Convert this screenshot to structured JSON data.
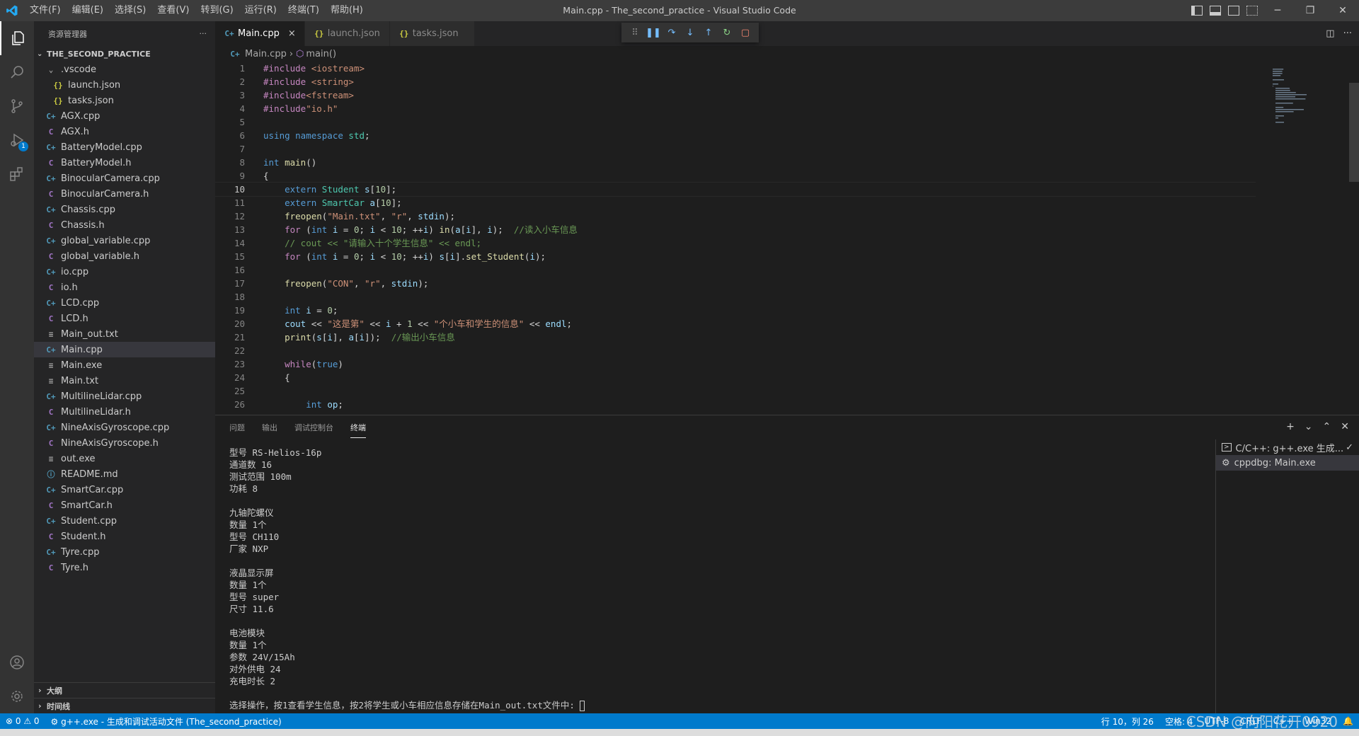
{
  "window": {
    "title": "Main.cpp - The_second_practice - Visual Studio Code",
    "menus": [
      "文件(F)",
      "编辑(E)",
      "选择(S)",
      "查看(V)",
      "转到(G)",
      "运行(R)",
      "终端(T)",
      "帮助(H)"
    ]
  },
  "activitybar": {
    "items": [
      {
        "icon": "files-icon",
        "active": true
      },
      {
        "icon": "search-icon"
      },
      {
        "icon": "source-control-icon"
      },
      {
        "icon": "run-debug-icon",
        "badge": "1"
      },
      {
        "icon": "extensions-icon"
      }
    ],
    "bottom": [
      {
        "icon": "account-icon"
      },
      {
        "icon": "settings-gear-icon"
      }
    ]
  },
  "sidebar": {
    "header": "资源管理器",
    "more": "···",
    "folder": "THE_SECOND_PRACTICE",
    "files": [
      {
        "name": ".vscode",
        "type": "folder",
        "indent": 1
      },
      {
        "name": "launch.json",
        "type": "json",
        "indent": 2
      },
      {
        "name": "tasks.json",
        "type": "json",
        "indent": 2
      },
      {
        "name": "AGX.cpp",
        "type": "cpp",
        "indent": 1
      },
      {
        "name": "AGX.h",
        "type": "h",
        "indent": 1
      },
      {
        "name": "BatteryModel.cpp",
        "type": "cpp",
        "indent": 1
      },
      {
        "name": "BatteryModel.h",
        "type": "h",
        "indent": 1
      },
      {
        "name": "BinocularCamera.cpp",
        "type": "cpp",
        "indent": 1
      },
      {
        "name": "BinocularCamera.h",
        "type": "h",
        "indent": 1
      },
      {
        "name": "Chassis.cpp",
        "type": "cpp",
        "indent": 1
      },
      {
        "name": "Chassis.h",
        "type": "h",
        "indent": 1
      },
      {
        "name": "global_variable.cpp",
        "type": "cpp",
        "indent": 1
      },
      {
        "name": "global_variable.h",
        "type": "h",
        "indent": 1
      },
      {
        "name": "io.cpp",
        "type": "cpp",
        "indent": 1
      },
      {
        "name": "io.h",
        "type": "h",
        "indent": 1
      },
      {
        "name": "LCD.cpp",
        "type": "cpp",
        "indent": 1
      },
      {
        "name": "LCD.h",
        "type": "h",
        "indent": 1
      },
      {
        "name": "Main_out.txt",
        "type": "txt",
        "indent": 1
      },
      {
        "name": "Main.cpp",
        "type": "cpp",
        "indent": 1,
        "selected": true
      },
      {
        "name": "Main.exe",
        "type": "txt",
        "indent": 1
      },
      {
        "name": "Main.txt",
        "type": "txt",
        "indent": 1
      },
      {
        "name": "MultilineLidar.cpp",
        "type": "cpp",
        "indent": 1
      },
      {
        "name": "MultilineLidar.h",
        "type": "h",
        "indent": 1
      },
      {
        "name": "NineAxisGyroscope.cpp",
        "type": "cpp",
        "indent": 1
      },
      {
        "name": "NineAxisGyroscope.h",
        "type": "h",
        "indent": 1
      },
      {
        "name": "out.exe",
        "type": "txt",
        "indent": 1
      },
      {
        "name": "README.md",
        "type": "md",
        "indent": 1
      },
      {
        "name": "SmartCar.cpp",
        "type": "cpp",
        "indent": 1
      },
      {
        "name": "SmartCar.h",
        "type": "h",
        "indent": 1
      },
      {
        "name": "Student.cpp",
        "type": "cpp",
        "indent": 1
      },
      {
        "name": "Student.h",
        "type": "h",
        "indent": 1
      },
      {
        "name": "Tyre.cpp",
        "type": "cpp",
        "indent": 1
      },
      {
        "name": "Tyre.h",
        "type": "h",
        "indent": 1
      }
    ],
    "outline": "大纲",
    "timeline": "时间线"
  },
  "tabs": [
    {
      "label": "Main.cpp",
      "type": "cpp",
      "active": true,
      "close": "×"
    },
    {
      "label": "launch.json",
      "type": "json"
    },
    {
      "label": "tasks.json",
      "type": "json"
    }
  ],
  "breadcrumb": {
    "file": "Main.cpp",
    "symbol": "main()"
  },
  "code": {
    "current_line": 10,
    "lines": [
      [
        [
          "p",
          "#include "
        ],
        [
          "s",
          "<iostream>"
        ]
      ],
      [
        [
          "p",
          "#include "
        ],
        [
          "s",
          "<string>"
        ]
      ],
      [
        [
          "p",
          "#include"
        ],
        [
          "s",
          "<fstream>"
        ]
      ],
      [
        [
          "p",
          "#include"
        ],
        [
          "s",
          "\"io.h\""
        ]
      ],
      [],
      [
        [
          "k",
          "using "
        ],
        [
          "k",
          "namespace "
        ],
        [
          "t",
          "std"
        ],
        [
          "d",
          ";"
        ]
      ],
      [],
      [
        [
          "k",
          "int "
        ],
        [
          "f",
          "main"
        ],
        [
          "d",
          "()"
        ]
      ],
      [
        [
          "d",
          "{"
        ]
      ],
      [
        [
          "d",
          "    "
        ],
        [
          "k",
          "extern "
        ],
        [
          "t",
          "Student "
        ],
        [
          "v",
          "s"
        ],
        [
          "d",
          "["
        ],
        [
          "n",
          "10"
        ],
        [
          "d",
          "];"
        ]
      ],
      [
        [
          "d",
          "    "
        ],
        [
          "k",
          "extern "
        ],
        [
          "t",
          "SmartCar "
        ],
        [
          "v",
          "a"
        ],
        [
          "d",
          "["
        ],
        [
          "n",
          "10"
        ],
        [
          "d",
          "];"
        ]
      ],
      [
        [
          "d",
          "    "
        ],
        [
          "f",
          "freopen"
        ],
        [
          "d",
          "("
        ],
        [
          "s",
          "\"Main.txt\""
        ],
        [
          "d",
          ", "
        ],
        [
          "s",
          "\"r\""
        ],
        [
          "d",
          ", "
        ],
        [
          "v",
          "stdin"
        ],
        [
          "d",
          ");"
        ]
      ],
      [
        [
          "d",
          "    "
        ],
        [
          "kc",
          "for "
        ],
        [
          "d",
          "("
        ],
        [
          "k",
          "int "
        ],
        [
          "v",
          "i "
        ],
        [
          "d",
          "= "
        ],
        [
          "n",
          "0"
        ],
        [
          "d",
          "; "
        ],
        [
          "v",
          "i "
        ],
        [
          "d",
          "< "
        ],
        [
          "n",
          "10"
        ],
        [
          "d",
          "; ++"
        ],
        [
          "v",
          "i"
        ],
        [
          "d",
          ") "
        ],
        [
          "f",
          "in"
        ],
        [
          "d",
          "("
        ],
        [
          "v",
          "a"
        ],
        [
          "d",
          "["
        ],
        [
          "v",
          "i"
        ],
        [
          "d",
          "], "
        ],
        [
          "v",
          "i"
        ],
        [
          "d",
          ");  "
        ],
        [
          "c",
          "//读入小车信息"
        ]
      ],
      [
        [
          "d",
          "    "
        ],
        [
          "c",
          "// cout << \"请输入十个学生信息\" << endl;"
        ]
      ],
      [
        [
          "d",
          "    "
        ],
        [
          "kc",
          "for "
        ],
        [
          "d",
          "("
        ],
        [
          "k",
          "int "
        ],
        [
          "v",
          "i "
        ],
        [
          "d",
          "= "
        ],
        [
          "n",
          "0"
        ],
        [
          "d",
          "; "
        ],
        [
          "v",
          "i "
        ],
        [
          "d",
          "< "
        ],
        [
          "n",
          "10"
        ],
        [
          "d",
          "; ++"
        ],
        [
          "v",
          "i"
        ],
        [
          "d",
          ") "
        ],
        [
          "v",
          "s"
        ],
        [
          "d",
          "["
        ],
        [
          "v",
          "i"
        ],
        [
          "d",
          "]."
        ],
        [
          "f",
          "set_Student"
        ],
        [
          "d",
          "("
        ],
        [
          "v",
          "i"
        ],
        [
          "d",
          ");"
        ]
      ],
      [],
      [
        [
          "d",
          "    "
        ],
        [
          "f",
          "freopen"
        ],
        [
          "d",
          "("
        ],
        [
          "s",
          "\"CON\""
        ],
        [
          "d",
          ", "
        ],
        [
          "s",
          "\"r\""
        ],
        [
          "d",
          ", "
        ],
        [
          "v",
          "stdin"
        ],
        [
          "d",
          ");"
        ]
      ],
      [],
      [
        [
          "d",
          "    "
        ],
        [
          "k",
          "int "
        ],
        [
          "v",
          "i "
        ],
        [
          "d",
          "= "
        ],
        [
          "n",
          "0"
        ],
        [
          "d",
          ";"
        ]
      ],
      [
        [
          "d",
          "    "
        ],
        [
          "v",
          "cout "
        ],
        [
          "d",
          "<< "
        ],
        [
          "s",
          "\"这是第\" "
        ],
        [
          "d",
          "<< "
        ],
        [
          "v",
          "i "
        ],
        [
          "d",
          "+ "
        ],
        [
          "n",
          "1 "
        ],
        [
          "d",
          "<< "
        ],
        [
          "s",
          "\"个小车和学生的信息\" "
        ],
        [
          "d",
          "<< "
        ],
        [
          "v",
          "endl"
        ],
        [
          "d",
          ";"
        ]
      ],
      [
        [
          "d",
          "    "
        ],
        [
          "f",
          "print"
        ],
        [
          "d",
          "("
        ],
        [
          "v",
          "s"
        ],
        [
          "d",
          "["
        ],
        [
          "v",
          "i"
        ],
        [
          "d",
          "], "
        ],
        [
          "v",
          "a"
        ],
        [
          "d",
          "["
        ],
        [
          "v",
          "i"
        ],
        [
          "d",
          "]);  "
        ],
        [
          "c",
          "//输出小车信息"
        ]
      ],
      [],
      [
        [
          "d",
          "    "
        ],
        [
          "kc",
          "while"
        ],
        [
          "d",
          "("
        ],
        [
          "k",
          "true"
        ],
        [
          "d",
          ")"
        ]
      ],
      [
        [
          "d",
          "    {"
        ]
      ],
      [],
      [
        [
          "d",
          "        "
        ],
        [
          "k",
          "int "
        ],
        [
          "v",
          "op"
        ],
        [
          "d",
          ";"
        ]
      ]
    ]
  },
  "panel": {
    "tabs": [
      "问题",
      "输出",
      "调试控制台",
      "终端"
    ],
    "active_tab": "终端",
    "actions": {
      "add": "+",
      "dropdown": "⌄",
      "maximize": "⌃",
      "close": "✕"
    },
    "terminal_lines": [
      "型号 RS-Helios-16p",
      "通道数 16",
      "测试范围 100m",
      "功耗 8",
      "",
      "九轴陀螺仪",
      "数量 1个",
      "型号 CH110",
      "厂家 NXP",
      "",
      "液晶显示屏",
      "数量 1个",
      "型号 super",
      "尺寸 11.6",
      "",
      "电池模块",
      "数量 1个",
      "参数 24V/15Ah",
      "对外供电 24",
      "充电时长 2",
      "",
      "选择操作，按1查看学生信息，按2将学生或小车相应信息存储在Main_out.txt文件中: "
    ],
    "terminals": [
      {
        "label": "C/C++: g++.exe 生成...",
        "check": "✓"
      },
      {
        "label": "cppdbg: Main.exe",
        "active": true
      }
    ]
  },
  "statusbar": {
    "problems": "⊗ 0 ⚠ 0",
    "task": "g++.exe - 生成和调试活动文件 (The_second_practice)",
    "position": "行 10，列 26",
    "spaces": "空格: 4",
    "encoding": "UTF-8",
    "eol": "CRLF",
    "language": "C++",
    "platform": "Win32"
  },
  "watermark": "CSDN @向阳花开0920",
  "colors": {
    "accent": "#007acc",
    "activity": "#333333",
    "sidebar": "#252526",
    "editor": "#1e1e1e"
  }
}
